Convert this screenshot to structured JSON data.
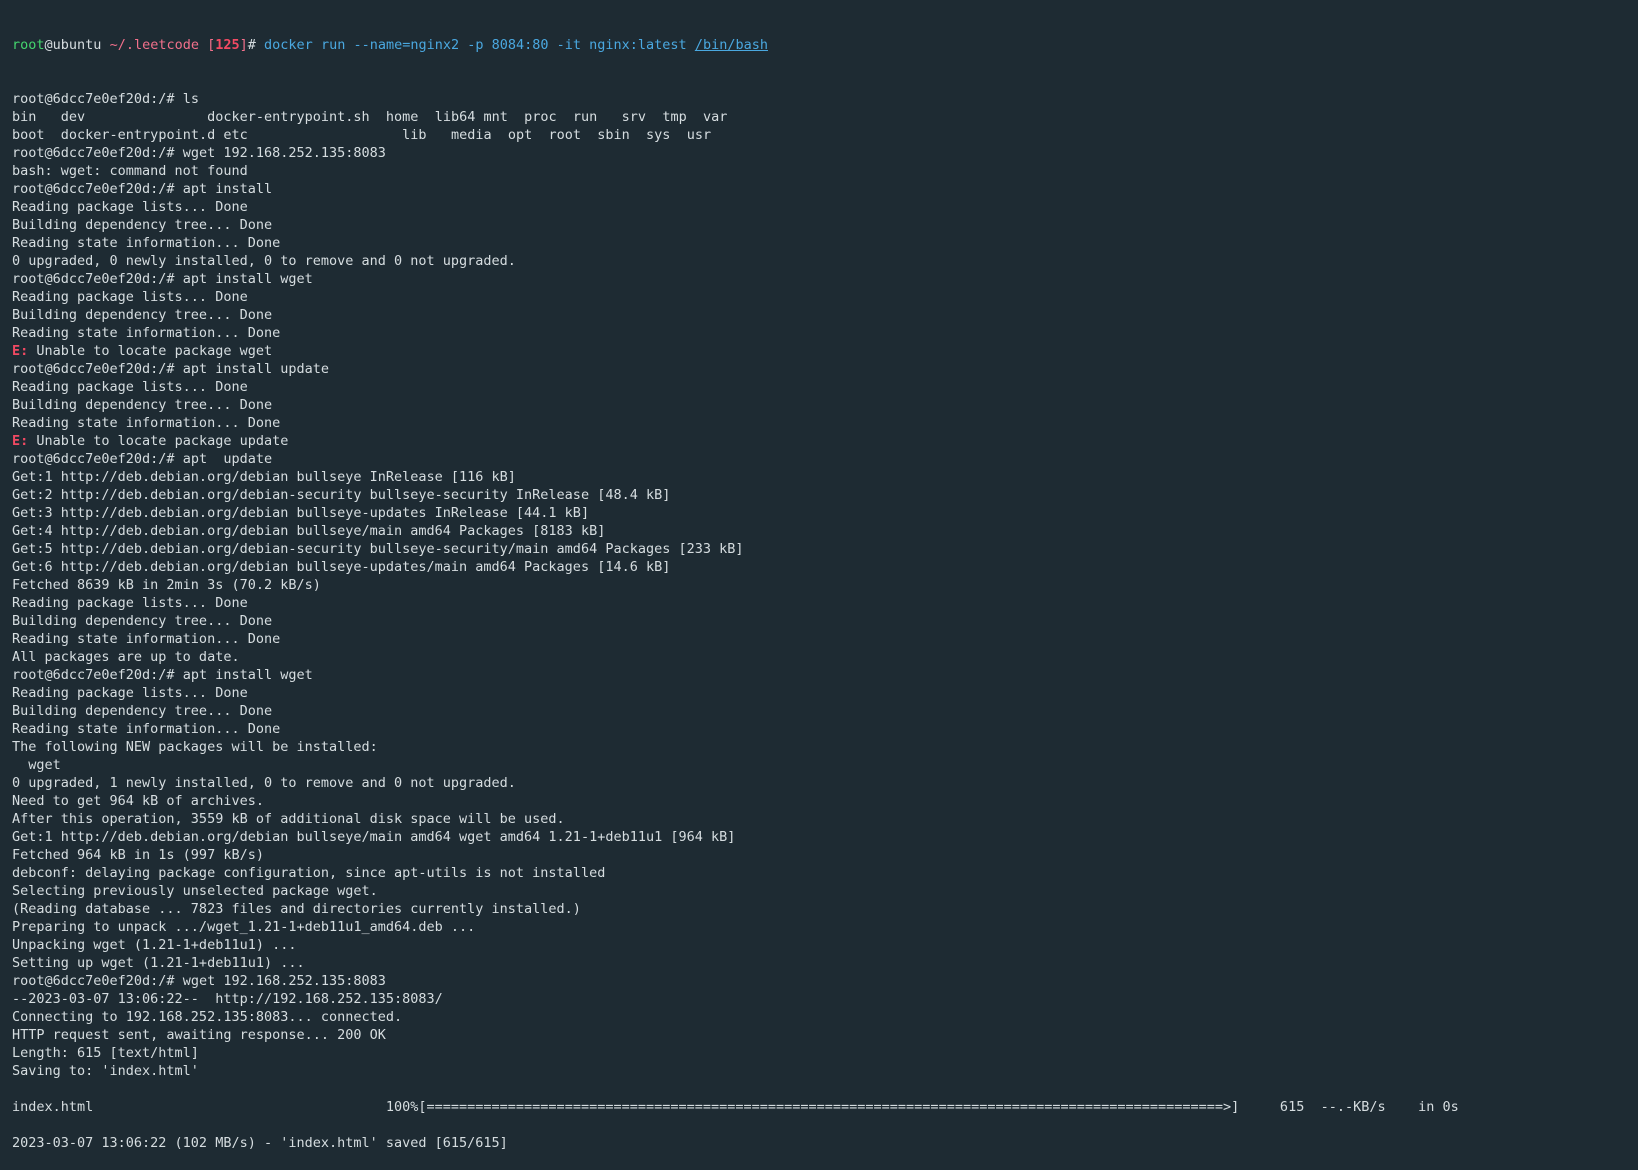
{
  "prompt_header": {
    "user": "root",
    "at_host": "@ubuntu",
    "path": "~/.leetcode",
    "status_open": "[",
    "status_code": "125",
    "status_close": "]",
    "hash": "# ",
    "command": "docker run --name=nginx2 -p 8084:80 -it nginx:latest ",
    "command_link": "/bin/bash"
  },
  "prompt": "root@6dcc7e0ef20d:/# ",
  "error_prefix": "E:",
  "ls_output": {
    "row1": [
      "bin",
      "dev",
      "docker-entrypoint.sh",
      "home",
      "lib64",
      "mnt",
      "proc",
      "run",
      "srv",
      "tmp",
      "var"
    ],
    "row2": [
      "boot",
      "docker-entrypoint.d",
      "etc",
      "",
      "lib",
      "media",
      "opt",
      "root",
      "sbin",
      "sys",
      "usr"
    ]
  },
  "lines": [
    {
      "type": "cmd",
      "text": "ls"
    },
    {
      "type": "ls1"
    },
    {
      "type": "ls2"
    },
    {
      "type": "cmd",
      "text": "wget 192.168.252.135:8083"
    },
    {
      "type": "out",
      "text": "bash: wget: command not found"
    },
    {
      "type": "cmd",
      "text": "apt install"
    },
    {
      "type": "out",
      "text": "Reading package lists... Done"
    },
    {
      "type": "out",
      "text": "Building dependency tree... Done"
    },
    {
      "type": "out",
      "text": "Reading state information... Done"
    },
    {
      "type": "out",
      "text": "0 upgraded, 0 newly installed, 0 to remove and 0 not upgraded."
    },
    {
      "type": "cmd",
      "text": "apt install wget"
    },
    {
      "type": "out",
      "text": "Reading package lists... Done"
    },
    {
      "type": "out",
      "text": "Building dependency tree... Done"
    },
    {
      "type": "out",
      "text": "Reading state information... Done"
    },
    {
      "type": "err",
      "text": " Unable to locate package wget"
    },
    {
      "type": "cmd",
      "text": "apt install update"
    },
    {
      "type": "out",
      "text": "Reading package lists... Done"
    },
    {
      "type": "out",
      "text": "Building dependency tree... Done"
    },
    {
      "type": "out",
      "text": "Reading state information... Done"
    },
    {
      "type": "err",
      "text": " Unable to locate package update"
    },
    {
      "type": "cmd",
      "text": "apt  update"
    },
    {
      "type": "out",
      "text": "Get:1 http://deb.debian.org/debian bullseye InRelease [116 kB]"
    },
    {
      "type": "out",
      "text": "Get:2 http://deb.debian.org/debian-security bullseye-security InRelease [48.4 kB]"
    },
    {
      "type": "out",
      "text": "Get:3 http://deb.debian.org/debian bullseye-updates InRelease [44.1 kB]"
    },
    {
      "type": "out",
      "text": "Get:4 http://deb.debian.org/debian bullseye/main amd64 Packages [8183 kB]"
    },
    {
      "type": "out",
      "text": "Get:5 http://deb.debian.org/debian-security bullseye-security/main amd64 Packages [233 kB]"
    },
    {
      "type": "out",
      "text": "Get:6 http://deb.debian.org/debian bullseye-updates/main amd64 Packages [14.6 kB]"
    },
    {
      "type": "out",
      "text": "Fetched 8639 kB in 2min 3s (70.2 kB/s)"
    },
    {
      "type": "out",
      "text": "Reading package lists... Done"
    },
    {
      "type": "out",
      "text": "Building dependency tree... Done"
    },
    {
      "type": "out",
      "text": "Reading state information... Done"
    },
    {
      "type": "out",
      "text": "All packages are up to date."
    },
    {
      "type": "cmd",
      "text": "apt install wget"
    },
    {
      "type": "out",
      "text": "Reading package lists... Done"
    },
    {
      "type": "out",
      "text": "Building dependency tree... Done"
    },
    {
      "type": "out",
      "text": "Reading state information... Done"
    },
    {
      "type": "out",
      "text": "The following NEW packages will be installed:"
    },
    {
      "type": "out",
      "text": "  wget"
    },
    {
      "type": "out",
      "text": "0 upgraded, 1 newly installed, 0 to remove and 0 not upgraded."
    },
    {
      "type": "out",
      "text": "Need to get 964 kB of archives."
    },
    {
      "type": "out",
      "text": "After this operation, 3559 kB of additional disk space will be used."
    },
    {
      "type": "out",
      "text": "Get:1 http://deb.debian.org/debian bullseye/main amd64 wget amd64 1.21-1+deb11u1 [964 kB]"
    },
    {
      "type": "out",
      "text": "Fetched 964 kB in 1s (997 kB/s)"
    },
    {
      "type": "out",
      "text": "debconf: delaying package configuration, since apt-utils is not installed"
    },
    {
      "type": "out",
      "text": "Selecting previously unselected package wget."
    },
    {
      "type": "out",
      "text": "(Reading database ... 7823 files and directories currently installed.)"
    },
    {
      "type": "out",
      "text": "Preparing to unpack .../wget_1.21-1+deb11u1_amd64.deb ..."
    },
    {
      "type": "out",
      "text": "Unpacking wget (1.21-1+deb11u1) ..."
    },
    {
      "type": "out",
      "text": "Setting up wget (1.21-1+deb11u1) ..."
    },
    {
      "type": "cmd",
      "text": "wget 192.168.252.135:8083"
    },
    {
      "type": "out",
      "text": "--2023-03-07 13:06:22--  http://192.168.252.135:8083/"
    },
    {
      "type": "out",
      "text": "Connecting to 192.168.252.135:8083... connected."
    },
    {
      "type": "out",
      "text": "HTTP request sent, awaiting response... 200 OK"
    },
    {
      "type": "out",
      "text": "Length: 615 [text/html]"
    },
    {
      "type": "out",
      "text": "Saving to: 'index.html'"
    },
    {
      "type": "blank"
    },
    {
      "type": "progress"
    },
    {
      "type": "blank"
    },
    {
      "type": "out",
      "text": "2023-03-07 13:06:22 (102 MB/s) - 'index.html' saved [615/615]"
    }
  ],
  "progress": {
    "file": "index.html",
    "percent": "100%",
    "bar": "[==================================================================================================>]",
    "size": "615",
    "rate": "--.-KB/s",
    "time": "in 0s",
    "fraction": 1.0
  },
  "colors": {
    "background": "#1e2b33",
    "text": "#d6dde0",
    "user_green": "#44d66e",
    "path_pink": "#f2708b",
    "command_cyan": "#4aa8e0",
    "error_red": "#f24a63"
  }
}
